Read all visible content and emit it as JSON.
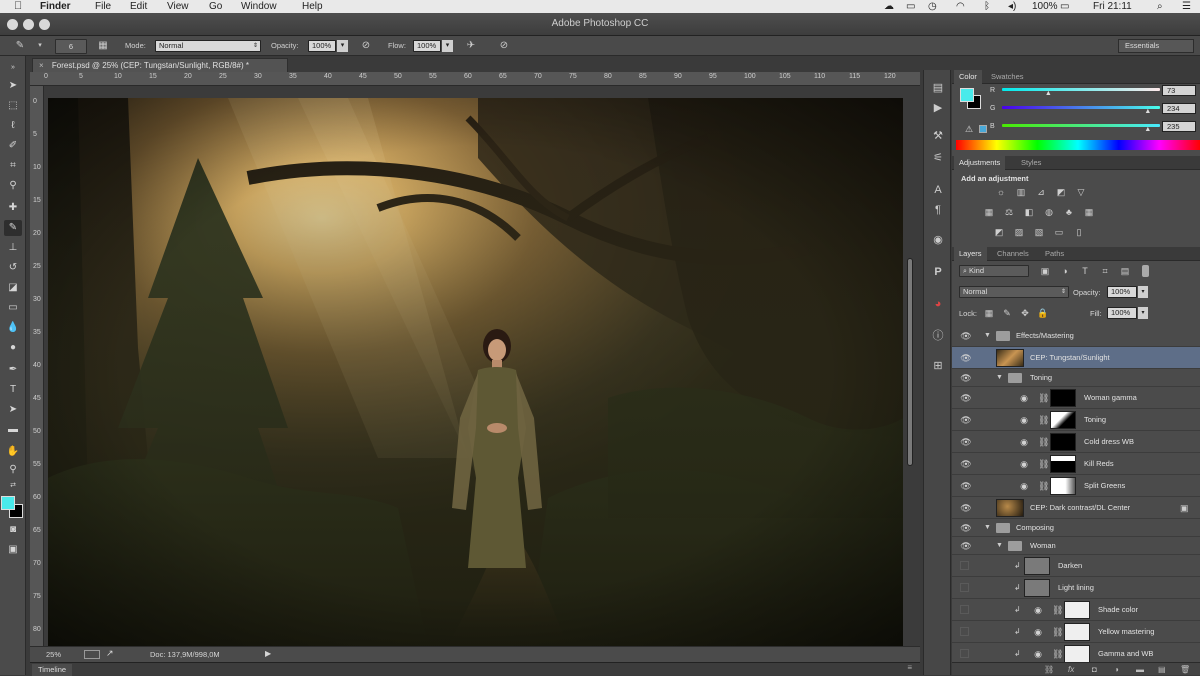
{
  "menubar": {
    "app": "Finder",
    "items": [
      "File",
      "Edit",
      "View",
      "Go",
      "Window",
      "Help"
    ],
    "battery": "100%",
    "clock": "Fri 21:11"
  },
  "window": {
    "title": "Adobe Photoshop CC"
  },
  "options": {
    "brush_size": "6",
    "mode_label": "Mode:",
    "mode_value": "Normal",
    "opacity_label": "Opacity:",
    "opacity_value": "100%",
    "flow_label": "Flow:",
    "flow_value": "100%",
    "workspace": "Essentials"
  },
  "document": {
    "tab_title": "Forest.psd @ 25% (CEP: Tungstan/Sunlight, RGB/8#) *",
    "zoom": "25%",
    "doc_size": "Doc: 137,9M/998,0M",
    "ruler_h": [
      "0",
      "5",
      "10",
      "15",
      "20",
      "25",
      "30",
      "35",
      "40",
      "45",
      "50",
      "55",
      "60",
      "65",
      "70",
      "75",
      "80",
      "85",
      "90",
      "95",
      "100",
      "105",
      "110",
      "115",
      "120"
    ],
    "ruler_v": [
      "0",
      "5",
      "10",
      "15",
      "20",
      "25",
      "30",
      "35",
      "40",
      "45",
      "50",
      "55",
      "60",
      "65",
      "70",
      "75",
      "80"
    ]
  },
  "timeline": {
    "label": "Timeline"
  },
  "color_panel": {
    "tabs": [
      "Color",
      "Swatches"
    ],
    "r_label": "R",
    "g_label": "G",
    "b_label": "B",
    "r": "73",
    "g": "234",
    "b": "235",
    "r_frac": 0.29,
    "g_frac": 0.92,
    "b_frac": 0.92,
    "foreground": "#49eaeb",
    "background": "#000000"
  },
  "adjustments_panel": {
    "tabs": [
      "Adjustments",
      "Styles"
    ],
    "heading": "Add an adjustment"
  },
  "layers_panel": {
    "tabs": [
      "Layers",
      "Channels",
      "Paths"
    ],
    "filter": "Kind",
    "blend_mode": "Normal",
    "opacity_label": "Opacity:",
    "opacity": "100%",
    "lock_label": "Lock:",
    "fill_label": "Fill:",
    "fill": "100%",
    "layers": [
      {
        "name": "Effects/Mastering"
      },
      {
        "name": "CEP: Tungstan/Sunlight"
      },
      {
        "name": "Toning"
      },
      {
        "name": "Woman gamma"
      },
      {
        "name": "Toning"
      },
      {
        "name": "Cold dress WB"
      },
      {
        "name": "Kill Reds"
      },
      {
        "name": "Split Greens"
      },
      {
        "name": "CEP: Dark contrast/DL Center"
      },
      {
        "name": "Composing"
      },
      {
        "name": "Woman"
      },
      {
        "name": "Darken"
      },
      {
        "name": "Light lining"
      },
      {
        "name": "Shade color"
      },
      {
        "name": "Yellow mastering"
      },
      {
        "name": "Gamma and WB"
      }
    ]
  }
}
